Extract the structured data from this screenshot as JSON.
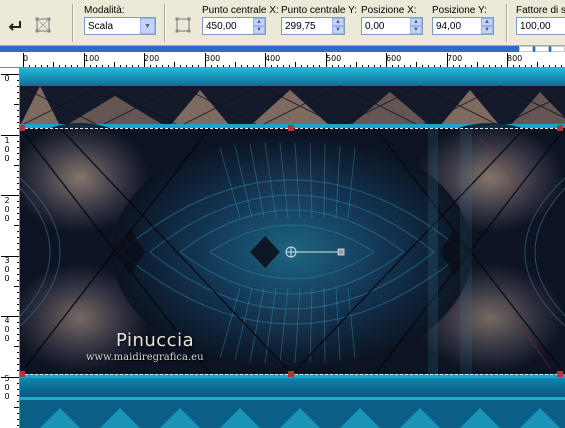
{
  "toolbar": {
    "modalita_label": "Modalità:",
    "modalita_value": "Scala",
    "punto_x_label": "Punto centrale X:",
    "punto_x_value": "450,00",
    "punto_y_label": "Punto centrale Y:",
    "punto_y_value": "299,75",
    "pos_x_label": "Posizione X:",
    "pos_x_value": "0,00",
    "pos_y_label": "Posizione Y:",
    "pos_y_value": "94,00",
    "fattore_label": "Fattore di sc",
    "fattore_value": "100,00"
  },
  "ruler_top": [
    "0",
    "100",
    "200",
    "300",
    "400",
    "500",
    "600",
    "700",
    "800"
  ],
  "ruler_left": [
    "0",
    "100",
    "200",
    "300",
    "400",
    "500"
  ],
  "watermark": {
    "title": "Pinuccia",
    "url": "www.maidiregrafica.eu"
  },
  "colors": {
    "selection_line": "#e8e8e8",
    "handle": "#b5323a",
    "teal_band": "#1b9cc4"
  }
}
